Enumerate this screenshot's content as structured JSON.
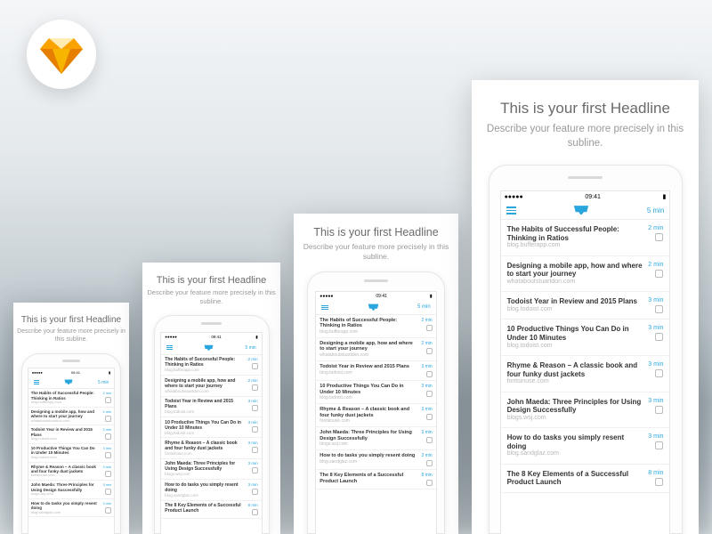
{
  "headline": "This is your first Headline",
  "subline": "Describe your feature more precisely in this subline.",
  "statusbar": {
    "time": "09:41",
    "carrier": "●●●●●",
    "battery": "▮"
  },
  "navbar": {
    "read_time": "5 min"
  },
  "articles": [
    {
      "title": "The Habits of Successful People: Thinking in Ratios",
      "source": "blog.bufferapp.com",
      "time": "2 min"
    },
    {
      "title": "Designing a mobile app, how and where to start your journey",
      "source": "whataboutstuartdon.com",
      "time": "2 min"
    },
    {
      "title": "Todoist Year in Review and 2015 Plans",
      "source": "blog.todoist.com",
      "time": "3 min"
    },
    {
      "title": "10 Productive Things You Can Do in Under 10 Minutes",
      "source": "blog.todoist.com",
      "time": "3 min"
    },
    {
      "title": "Rhyme & Reason – A classic book and four funky dust jackets",
      "source": "fontsinuse.com",
      "time": "3 min"
    },
    {
      "title": "John Maeda: Three Principles for Using Design Successfully",
      "source": "blogs.wsj.com",
      "time": "3 min"
    },
    {
      "title": "How to do tasks you simply resent doing",
      "source": "blog.sandglaz.com",
      "time": "3 min"
    },
    {
      "title": "The 8 Key Elements of a Successful Product Launch",
      "source": "",
      "time": "8 min"
    }
  ],
  "card_limits": [
    7,
    8,
    8,
    8
  ]
}
